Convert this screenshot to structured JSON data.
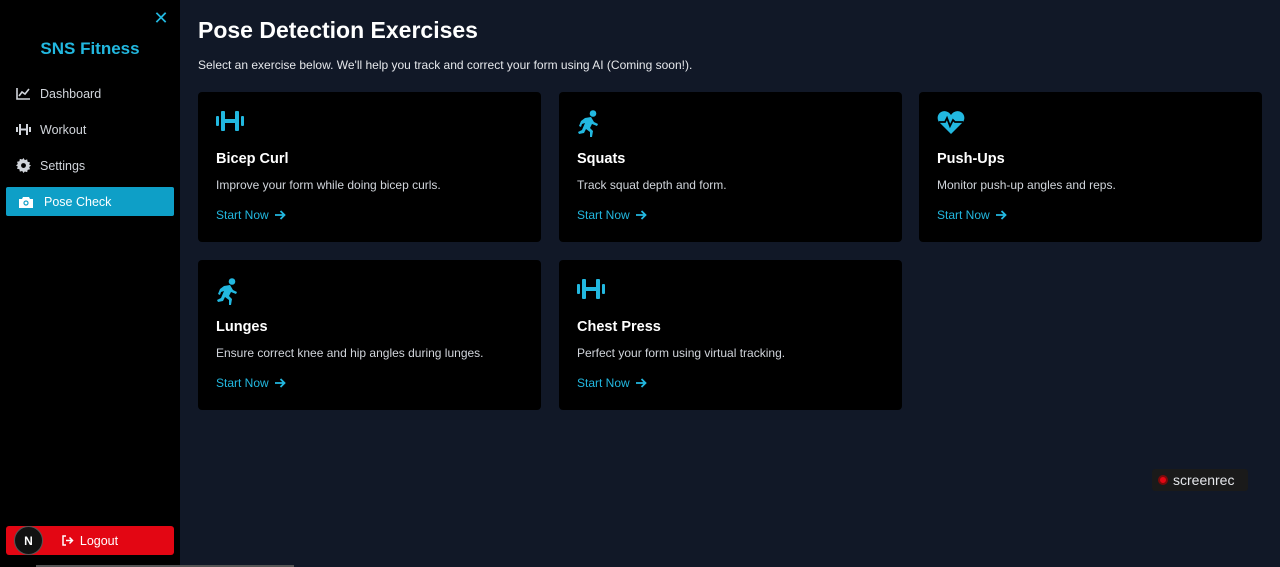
{
  "sidebar": {
    "close_glyph": "✕",
    "brand": "SNS Fitness",
    "items": [
      {
        "label": "Dashboard",
        "icon": "chart-line-icon"
      },
      {
        "label": "Workout",
        "icon": "dumbbell-icon"
      },
      {
        "label": "Settings",
        "icon": "gear-icon"
      },
      {
        "label": "Pose Check",
        "icon": "camera-icon",
        "active": true
      }
    ],
    "logout_label": "Logout",
    "avatar_letter": "N"
  },
  "main": {
    "title": "Pose Detection Exercises",
    "subtitle": "Select an exercise below. We'll help you track and correct your form using AI (Coming soon!).",
    "cards": [
      {
        "title": "Bicep Curl",
        "description": "Improve your form while doing bicep curls.",
        "cta": "Start Now",
        "icon": "dumbbell-icon"
      },
      {
        "title": "Squats",
        "description": "Track squat depth and form.",
        "cta": "Start Now",
        "icon": "running-icon"
      },
      {
        "title": "Push-Ups",
        "description": "Monitor push-up angles and reps.",
        "cta": "Start Now",
        "icon": "heart-pulse-icon"
      },
      {
        "title": "Lunges",
        "description": "Ensure correct knee and hip angles during lunges.",
        "cta": "Start Now",
        "icon": "running-icon"
      },
      {
        "title": "Chest Press",
        "description": "Perfect your form using virtual tracking.",
        "cta": "Start Now",
        "icon": "dumbbell-icon"
      }
    ]
  },
  "watermark": "screenrec",
  "colors": {
    "accent": "#22b8e0",
    "active_nav": "#0e9fc7",
    "logout": "#e30613",
    "background": "#111827",
    "card": "#000000"
  }
}
